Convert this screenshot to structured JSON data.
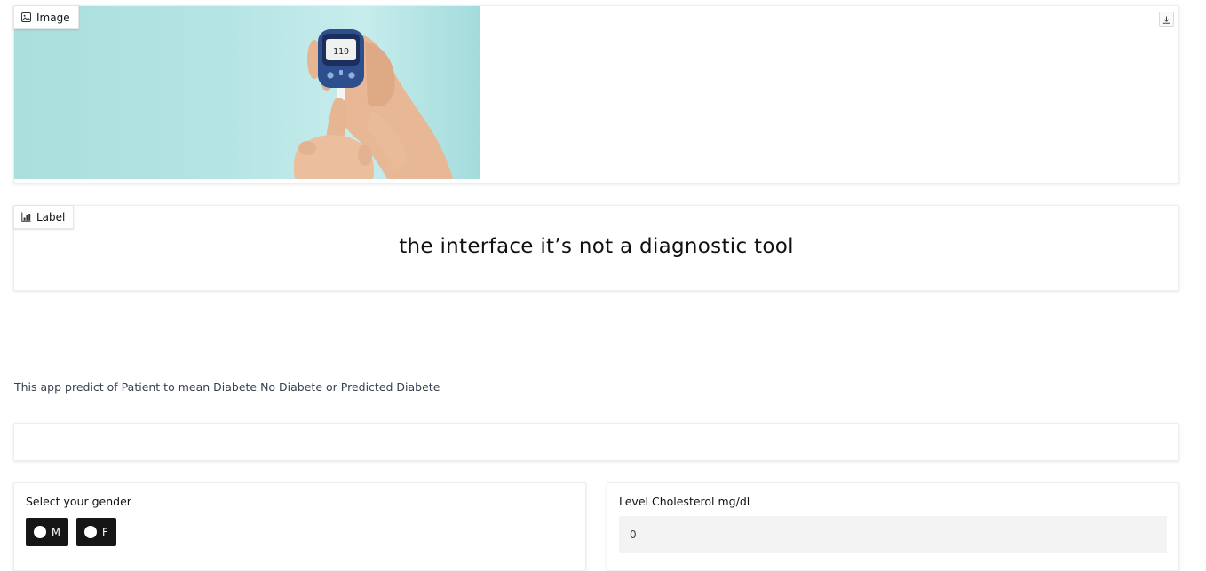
{
  "image_panel": {
    "tag_label": "Image",
    "tag_icon": "image-icon",
    "download_icon": "download-icon",
    "meter_reading": "110"
  },
  "label_panel": {
    "tag_label": "Label",
    "tag_icon": "bar-chart-icon",
    "text": "the interface it’s not a diagnostic tool"
  },
  "description": "This app predict of Patient to mean Diabete No Diabete or Predicted Diabete",
  "gender": {
    "label": "Select your gender",
    "options": [
      "M",
      "F"
    ]
  },
  "cholesterol": {
    "label": "Level Cholesterol mg/dl",
    "value": "0"
  },
  "colors": {
    "accent_dark": "#161616",
    "photo_bg": "#b5e4e4"
  }
}
